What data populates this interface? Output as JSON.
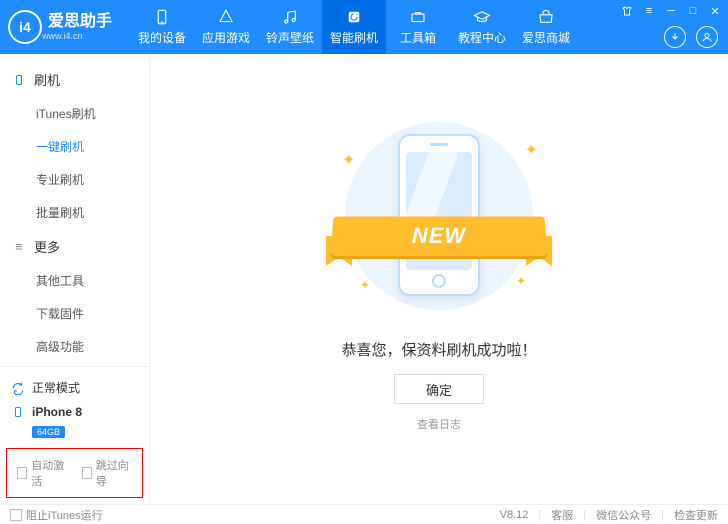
{
  "header": {
    "app_name": "爱思助手",
    "app_url": "www.i4.cn",
    "logo_letters": "i4",
    "nav": [
      {
        "label": "我的设备",
        "active": false
      },
      {
        "label": "应用游戏",
        "active": false
      },
      {
        "label": "铃声壁纸",
        "active": false
      },
      {
        "label": "智能刷机",
        "active": true
      },
      {
        "label": "工具箱",
        "active": false
      },
      {
        "label": "教程中心",
        "active": false
      },
      {
        "label": "爱思商城",
        "active": false
      }
    ]
  },
  "sidebar": {
    "group_flash": "刷机",
    "items_flash": [
      {
        "label": "iTunes刷机",
        "active": false
      },
      {
        "label": "一键刷机",
        "active": true
      },
      {
        "label": "专业刷机",
        "active": false
      },
      {
        "label": "批量刷机",
        "active": false
      }
    ],
    "group_more": "更多",
    "items_more": [
      {
        "label": "其他工具",
        "active": false
      },
      {
        "label": "下载固件",
        "active": false
      },
      {
        "label": "高级功能",
        "active": false
      }
    ],
    "mode_label": "正常模式",
    "device_name": "iPhone 8",
    "device_storage": "64GB",
    "chk_auto_activate": "自动激活",
    "chk_skip_wizard": "跳过向导"
  },
  "main": {
    "ribbon_text": "NEW",
    "success_text": "恭喜您，保资料刷机成功啦！",
    "ok_label": "确定",
    "log_link": "查看日志"
  },
  "footer": {
    "block_itunes": "阻止iTunes运行",
    "version": "V8.12",
    "support": "客服",
    "wechat": "微信公众号",
    "check_update": "检查更新"
  }
}
